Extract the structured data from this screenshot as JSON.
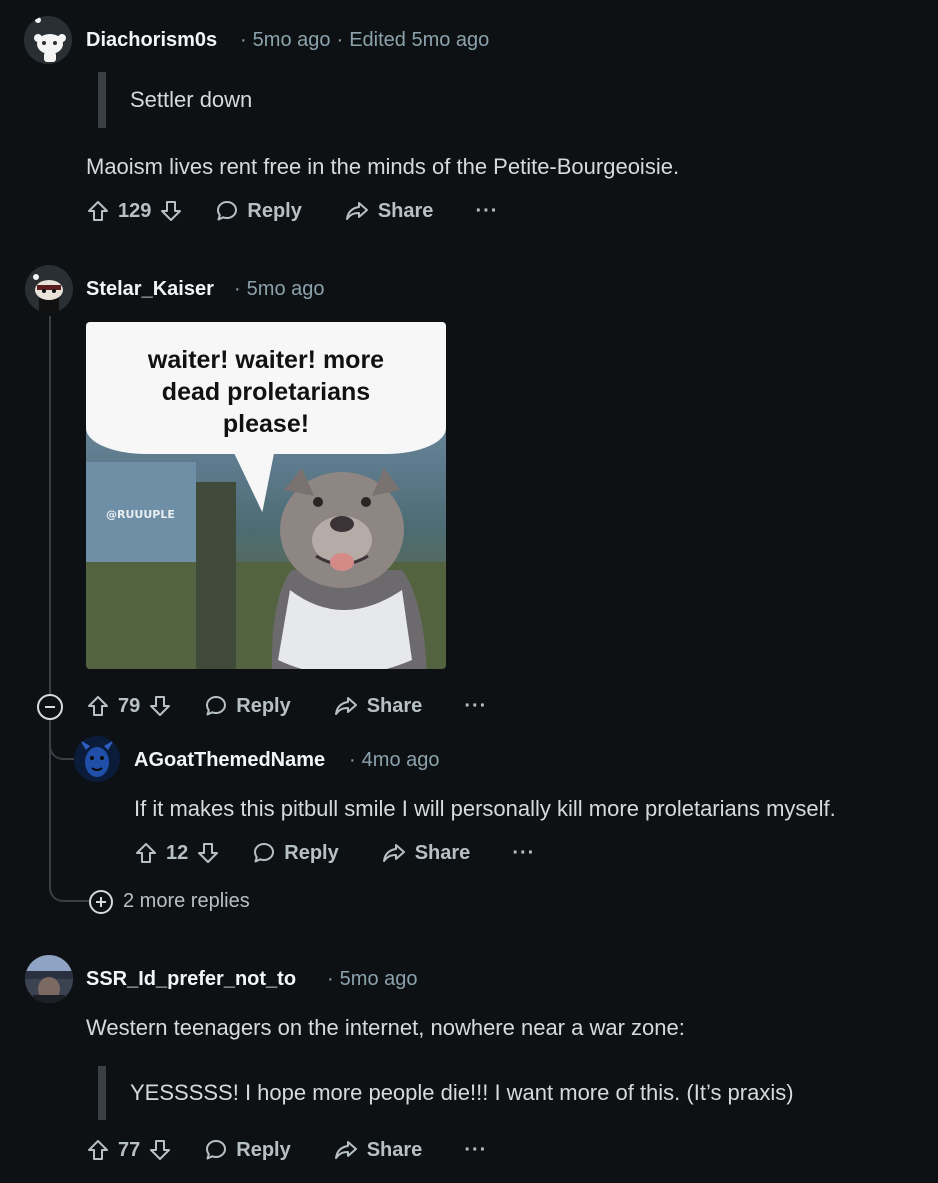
{
  "comments": [
    {
      "username": "Diachorism0s",
      "time": "5mo ago",
      "edited": "Edited 5mo ago",
      "quote": "Settler down",
      "body": "Maoism lives rent free in the minds of the Petite-Bourgeoisie.",
      "votes": "129",
      "reply_label": "Reply",
      "share_label": "Share",
      "more_label": "···"
    },
    {
      "username": "Stelar_Kaiser",
      "time": "5mo ago",
      "image": {
        "caption_line1": "waiter! waiter! more",
        "caption_line2": "dead proletarians",
        "caption_line3": "please!",
        "watermark": "@RUUUPLE"
      },
      "votes": "79",
      "reply_label": "Reply",
      "share_label": "Share",
      "more_label": "···",
      "more_replies": "2 more replies",
      "replies": [
        {
          "username": "AGoatThemedName",
          "time": "4mo ago",
          "body": "If it makes this pitbull smile I will personally kill more proletarians myself.",
          "votes": "12",
          "reply_label": "Reply",
          "share_label": "Share",
          "more_label": "···"
        }
      ]
    },
    {
      "username": "SSR_Id_prefer_not_to",
      "time": "5mo ago",
      "body": "Western teenagers on the internet, nowhere near a war zone:",
      "quote": "YESSSSS! I hope more people die!!! I want more of this. (It’s praxis)",
      "votes": "77",
      "reply_label": "Reply",
      "share_label": "Share",
      "more_label": "···"
    }
  ],
  "colors": {
    "background": "#0e1113",
    "text": "#d7dadc",
    "meta": "#8ba2ad",
    "thread_line": "#3a3f44"
  }
}
